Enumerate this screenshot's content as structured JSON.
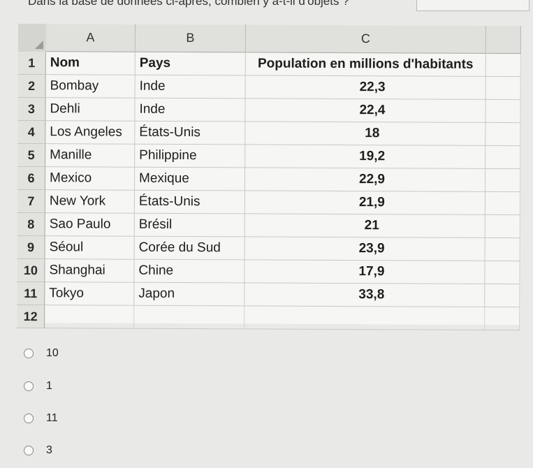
{
  "question": {
    "text": "Dans la base de données ci-après, combien y a-t-il d'objets ?"
  },
  "spreadsheet": {
    "columns": [
      "A",
      "B",
      "C"
    ],
    "rows": [
      {
        "num": "1",
        "cells": [
          "Nom",
          "Pays",
          "Population en millions d'habitants"
        ]
      },
      {
        "num": "2",
        "cells": [
          "Bombay",
          "Inde",
          "22,3"
        ]
      },
      {
        "num": "3",
        "cells": [
          "Dehli",
          "Inde",
          "22,4"
        ]
      },
      {
        "num": "4",
        "cells": [
          "Los Angeles",
          "États-Unis",
          "18"
        ]
      },
      {
        "num": "5",
        "cells": [
          "Manille",
          "Philippine",
          "19,2"
        ]
      },
      {
        "num": "6",
        "cells": [
          "Mexico",
          "Mexique",
          "22,9"
        ]
      },
      {
        "num": "7",
        "cells": [
          "New York",
          "États-Unis",
          "21,9"
        ]
      },
      {
        "num": "8",
        "cells": [
          "Sao Paulo",
          "Brésil",
          "21"
        ]
      },
      {
        "num": "9",
        "cells": [
          "Séoul",
          "Corée du Sud",
          "23,9"
        ]
      },
      {
        "num": "10",
        "cells": [
          "Shanghai",
          "Chine",
          "17,9"
        ]
      },
      {
        "num": "11",
        "cells": [
          "Tokyo",
          "Japon",
          "33,8"
        ]
      },
      {
        "num": "12",
        "cells": [
          "",
          "",
          ""
        ]
      }
    ]
  },
  "options": [
    {
      "label": "10"
    },
    {
      "label": "1"
    },
    {
      "label": "11"
    },
    {
      "label": "3"
    }
  ]
}
